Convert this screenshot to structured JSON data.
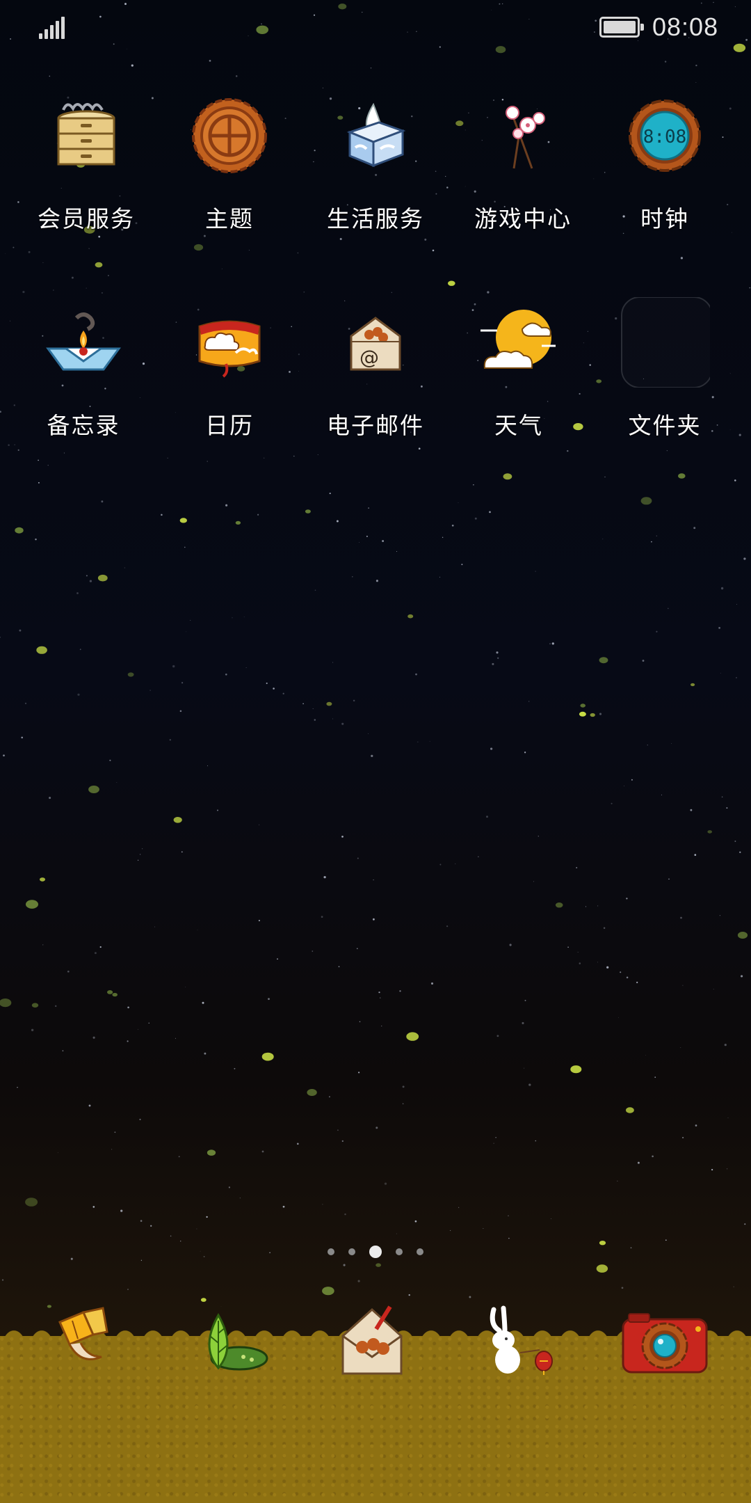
{
  "status_bar": {
    "time": "08:08",
    "signal_icon": "signal-icon",
    "battery_icon": "battery-icon"
  },
  "home": {
    "rows": [
      [
        {
          "label": "会员服务",
          "icon": "steamer-icon"
        },
        {
          "label": "主题",
          "icon": "mooncake-icon"
        },
        {
          "label": "生活服务",
          "icon": "tissue-box-icon"
        },
        {
          "label": "游戏中心",
          "icon": "blossom-branch-icon"
        },
        {
          "label": "时钟",
          "icon": "clock-icon",
          "clock_face": "8:08"
        }
      ],
      [
        {
          "label": "备忘录",
          "icon": "boat-lantern-icon"
        },
        {
          "label": "日历",
          "icon": "cloud-calendar-icon"
        },
        {
          "label": "电子邮件",
          "icon": "envelope-icon",
          "glyph": "@"
        },
        {
          "label": "天气",
          "icon": "moon-cloud-icon"
        },
        {
          "label": "文件夹",
          "icon": "folder-icon"
        }
      ]
    ]
  },
  "page_indicator": {
    "count": 5,
    "active_index": 2
  },
  "dock": [
    {
      "icon": "lantern-phone-icon"
    },
    {
      "icon": "leaf-messages-icon"
    },
    {
      "icon": "envelope-browser-icon"
    },
    {
      "icon": "rabbit-contacts-icon"
    },
    {
      "icon": "camera-icon"
    }
  ],
  "colors": {
    "sky_top": "#04070f",
    "ground": "#8e7112",
    "moon": "#f5b51b",
    "clock_face": "#1fb1c8",
    "label": "#ffffff"
  }
}
